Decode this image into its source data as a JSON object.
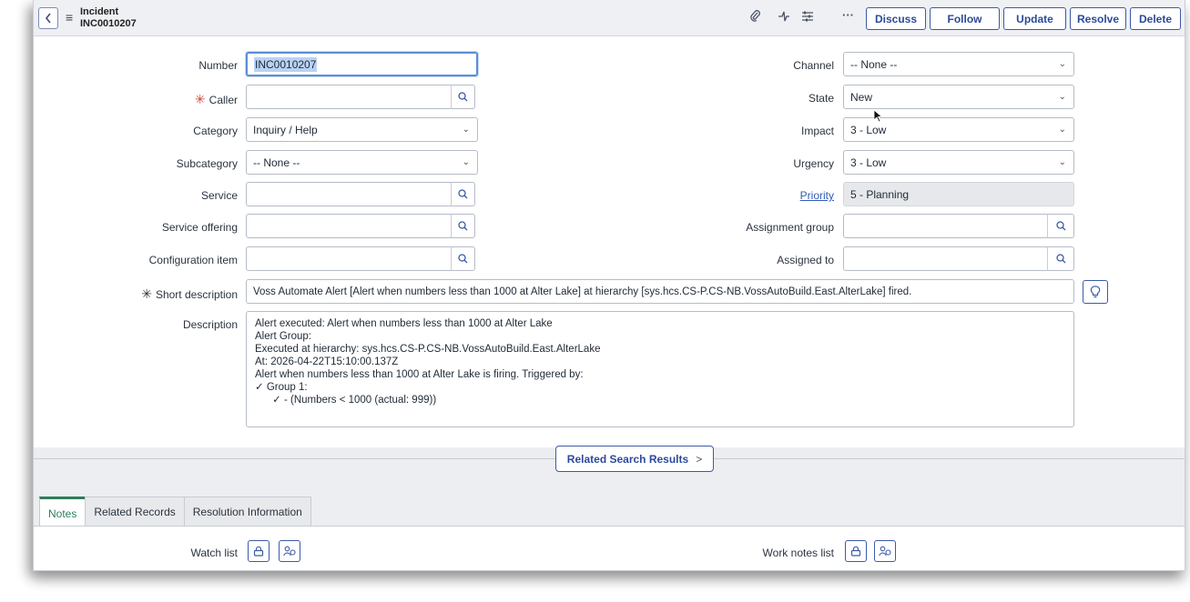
{
  "header": {
    "record_type": "Incident",
    "record_number": "INC0010207",
    "icons": [
      "paperclip-icon",
      "activity-icon",
      "settings-sliders-icon",
      "more-icon"
    ],
    "buttons": {
      "discuss": "Discuss",
      "follow": "Follow",
      "update": "Update",
      "resolve": "Resolve",
      "delete": "Delete"
    }
  },
  "form": {
    "number": {
      "label": "Number",
      "value": "INC0010207"
    },
    "caller": {
      "label": "Caller",
      "value": ""
    },
    "category": {
      "label": "Category",
      "value": "Inquiry / Help"
    },
    "subcategory": {
      "label": "Subcategory",
      "value": "-- None --"
    },
    "service": {
      "label": "Service",
      "value": ""
    },
    "service_offering": {
      "label": "Service offering",
      "value": ""
    },
    "configuration_item": {
      "label": "Configuration item",
      "value": ""
    },
    "channel": {
      "label": "Channel",
      "value": "-- None --"
    },
    "state": {
      "label": "State",
      "value": "New"
    },
    "impact": {
      "label": "Impact",
      "value": "3 - Low"
    },
    "urgency": {
      "label": "Urgency",
      "value": "3 - Low"
    },
    "priority": {
      "label": "Priority",
      "value": "5 - Planning"
    },
    "assignment_group": {
      "label": "Assignment group",
      "value": ""
    },
    "assigned_to": {
      "label": "Assigned to",
      "value": ""
    },
    "short_description": {
      "label": "Short description",
      "value": "Voss Automate Alert [Alert when numbers less than 1000 at Alter Lake] at hierarchy [sys.hcs.CS-P.CS-NB.VossAutoBuild.East.AlterLake] fired."
    },
    "description": {
      "label": "Description",
      "lines": [
        "Alert executed: Alert when numbers less than 1000 at Alter Lake",
        "Alert Group:",
        "Executed at hierarchy: sys.hcs.CS-P.CS-NB.VossAutoBuild.East.AlterLake",
        "At: 2026-04-22T15:10:00.137Z",
        "Alert when numbers less than 1000 at Alter Lake is firing. Triggered by:",
        "✓ Group 1:",
        "      ✓ - (Numbers < 1000 (actual: 999))"
      ]
    }
  },
  "related_search": {
    "label": "Related Search Results",
    "chevron": ">"
  },
  "tabs": [
    {
      "label": "Notes",
      "active": true
    },
    {
      "label": "Related Records",
      "active": false
    },
    {
      "label": "Resolution Information",
      "active": false
    }
  ],
  "notes": {
    "watch_list_label": "Watch list",
    "work_notes_list_label": "Work notes list"
  },
  "colors": {
    "accent_blue": "#2c4a99",
    "required_red": "#d0463c",
    "tab_active_green": "#2e7d5b",
    "focus_blue": "#5a8fd6"
  }
}
